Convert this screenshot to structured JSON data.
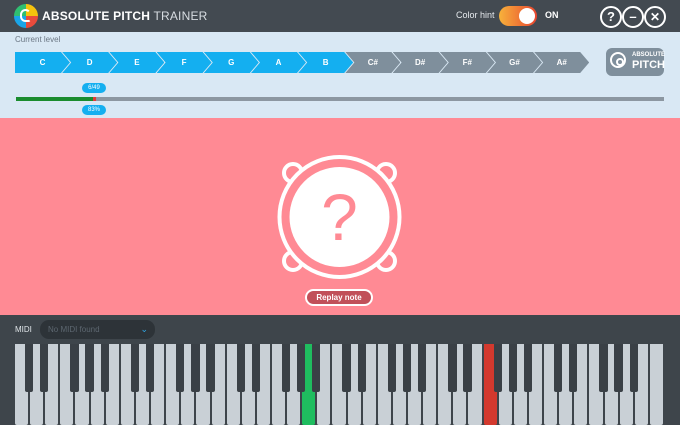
{
  "app": {
    "title_bold": "ABSOLUTE PITCH",
    "title_light": " TRAINER"
  },
  "header": {
    "color_hint_label": "Color hint",
    "color_hint_state": "ON",
    "help_symbol": "?",
    "minimize_symbol": "–",
    "close_symbol": "✕"
  },
  "level": {
    "label": "Current level",
    "notes": [
      {
        "label": "C",
        "active": true
      },
      {
        "label": "D",
        "active": true
      },
      {
        "label": "E",
        "active": true
      },
      {
        "label": "F",
        "active": true
      },
      {
        "label": "G",
        "active": true
      },
      {
        "label": "A",
        "active": true
      },
      {
        "label": "B",
        "active": true
      },
      {
        "label": "C#",
        "active": false
      },
      {
        "label": "D#",
        "active": false
      },
      {
        "label": "F#",
        "active": false
      },
      {
        "label": "G#",
        "active": false
      },
      {
        "label": "A#",
        "active": false
      }
    ],
    "badge_top": "ABSOLUTE",
    "badge_bottom": "PITCH",
    "progress_count": "6/49",
    "progress_percent_label": "83%",
    "progress_fraction": 0.12
  },
  "main": {
    "question_symbol": "?",
    "replay_label": "Replay note"
  },
  "midi": {
    "label": "MIDI",
    "selected": "No MIDI found"
  },
  "keyboard": {
    "white_key_count": 43,
    "green_key_index": 19,
    "red_key_index": 31
  },
  "colors": {
    "accent": "#14aff0",
    "main_bg": "#ff8a94",
    "correct": "#1fbd5f",
    "wrong": "#d3392e"
  }
}
